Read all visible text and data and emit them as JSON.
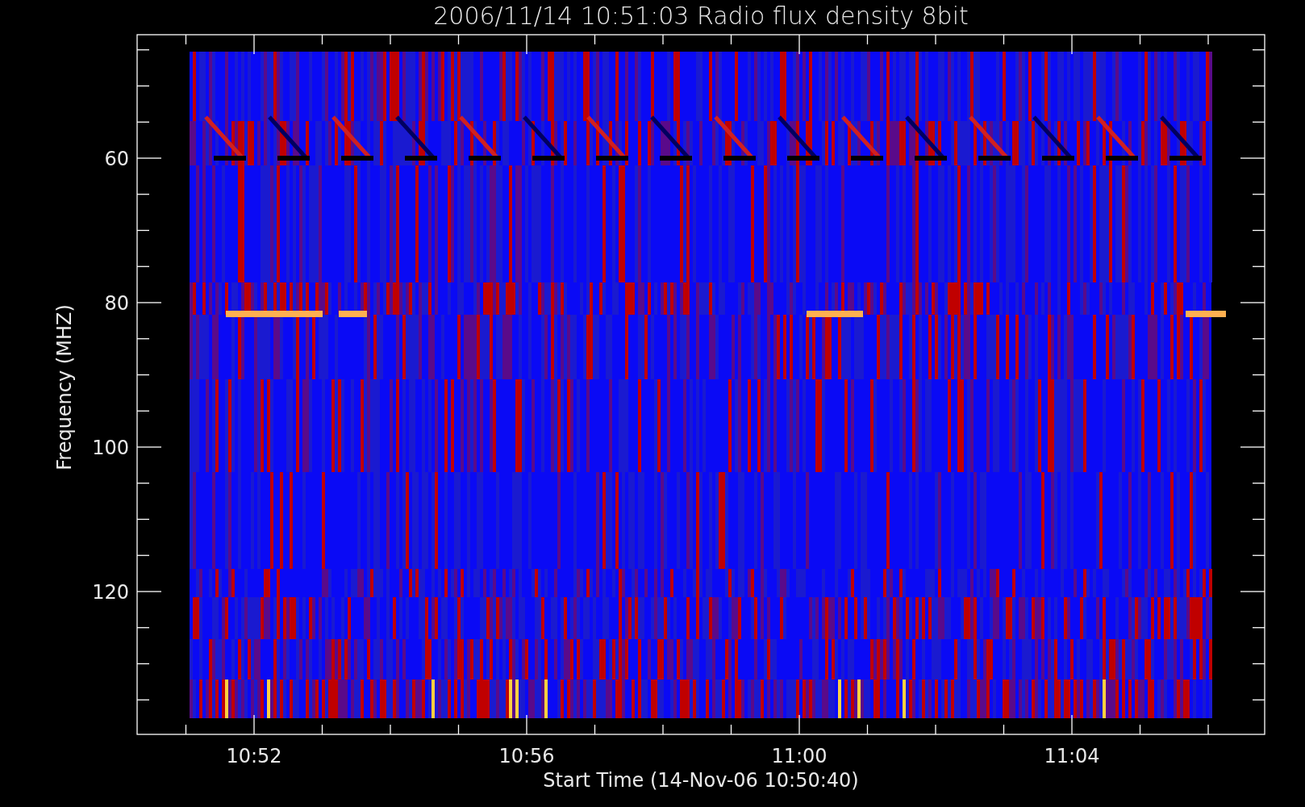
{
  "chart_title": "2006/11/14 10:51:03 Radio flux density 8bit",
  "y_axis": {
    "label": "Frequency (MHZ)",
    "tick_labels": [
      "60",
      "80",
      "100",
      "120"
    ]
  },
  "x_axis": {
    "label": "Start Time (14-Nov-06 10:50:40)",
    "tick_labels": [
      "10:52",
      "10:56",
      "11:00",
      "11:04"
    ]
  }
}
